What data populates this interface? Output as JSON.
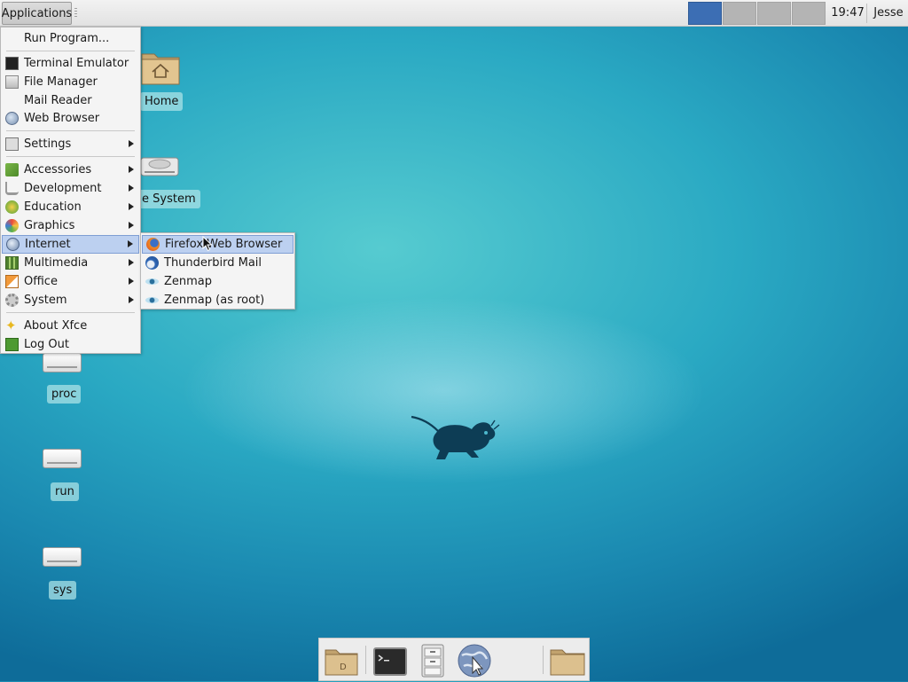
{
  "panel": {
    "applications_label": "Applications",
    "workspaces": [
      "workspace-1",
      "workspace-2",
      "workspace-3",
      "workspace-4"
    ],
    "active_workspace": 1,
    "clock": "19:47",
    "user": "Jesse"
  },
  "desktop": {
    "icons": [
      {
        "label": "Home",
        "icon": "home-folder-icon"
      },
      {
        "label": "e System",
        "icon": "filesystem-drive-icon"
      },
      {
        "label": "proc",
        "icon": "drive-icon"
      },
      {
        "label": "run",
        "icon": "drive-icon"
      },
      {
        "label": "sys",
        "icon": "drive-icon"
      }
    ]
  },
  "app_menu": {
    "items": [
      {
        "label": "Run Program...",
        "icon": ""
      },
      {
        "label": "Terminal Emulator",
        "icon": "terminal-icon"
      },
      {
        "label": "File Manager",
        "icon": "file-manager-icon"
      },
      {
        "label": "Mail Reader",
        "icon": ""
      },
      {
        "label": "Web Browser",
        "icon": "web-browser-icon"
      },
      {
        "label": "Settings",
        "icon": "settings-icon",
        "submenu": true
      },
      {
        "label": "Accessories",
        "icon": "accessories-icon",
        "submenu": true
      },
      {
        "label": "Development",
        "icon": "development-icon",
        "submenu": true
      },
      {
        "label": "Education",
        "icon": "education-icon",
        "submenu": true
      },
      {
        "label": "Graphics",
        "icon": "graphics-icon",
        "submenu": true
      },
      {
        "label": "Internet",
        "icon": "internet-icon",
        "submenu": true,
        "highlighted": true
      },
      {
        "label": "Multimedia",
        "icon": "multimedia-icon",
        "submenu": true
      },
      {
        "label": "Office",
        "icon": "office-icon",
        "submenu": true
      },
      {
        "label": "System",
        "icon": "system-gear-icon",
        "submenu": true
      },
      {
        "label": "About Xfce",
        "icon": "about-star-icon"
      },
      {
        "label": "Log Out",
        "icon": "logout-icon"
      }
    ]
  },
  "internet_submenu": {
    "items": [
      {
        "label": "Firefox Web Browser",
        "icon": "firefox-icon",
        "highlighted": true
      },
      {
        "label": "Thunderbird Mail",
        "icon": "thunderbird-icon"
      },
      {
        "label": "Zenmap",
        "icon": "zenmap-eye-icon"
      },
      {
        "label": "Zenmap (as root)",
        "icon": "zenmap-eye-icon"
      }
    ]
  },
  "dock": {
    "items": [
      "show-desktop-icon",
      "terminal-icon",
      "file-manager-icon",
      "web-browser-icon",
      "folder-icon"
    ]
  },
  "colors": {
    "accent": "#3c6eb4",
    "highlight": "#bcd0f0",
    "desktop": "#2aa9c3"
  }
}
